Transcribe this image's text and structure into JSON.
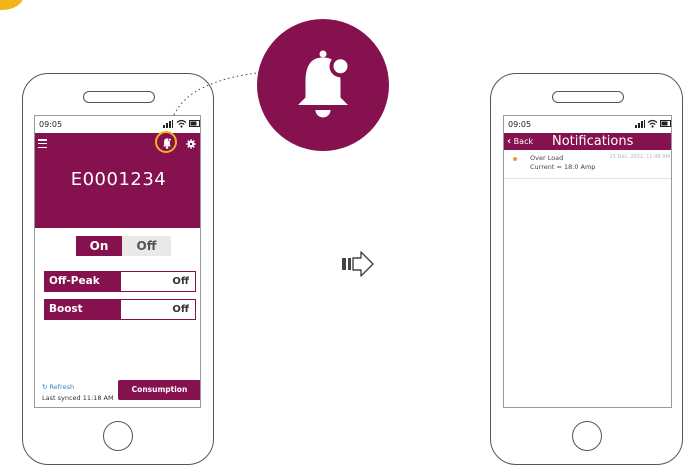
{
  "left_phone": {
    "time": "09:05",
    "device_id": "E0001234",
    "power_toggle": {
      "on_label": "On",
      "off_label": "Off",
      "selected": "On"
    },
    "settings": [
      {
        "label": "Off-Peak",
        "value": "Off"
      },
      {
        "label": "Boost",
        "value": "Off"
      }
    ],
    "refresh_label": "Refresh",
    "last_synced": "Last synced 11:18 AM",
    "consumption_button": "Consumption Trends"
  },
  "right_phone": {
    "time": "09:05",
    "back_label": "Back",
    "title": "Notifications",
    "notifications": [
      {
        "title": "Over Load",
        "detail": "Current = 18.0 Amp",
        "timestamp": "15 Dec, 2022, 11:48 AM",
        "dot_color": "#f39c33"
      }
    ]
  },
  "colors": {
    "brand": "#86114f",
    "highlight": "#f2b31b",
    "link": "#2f80c9"
  },
  "icons": [
    "bell-icon",
    "gear-icon",
    "menu-icon",
    "refresh-icon",
    "back-chevron-icon",
    "arrow-right-icon",
    "signal-icon",
    "wifi-icon",
    "battery-icon"
  ]
}
